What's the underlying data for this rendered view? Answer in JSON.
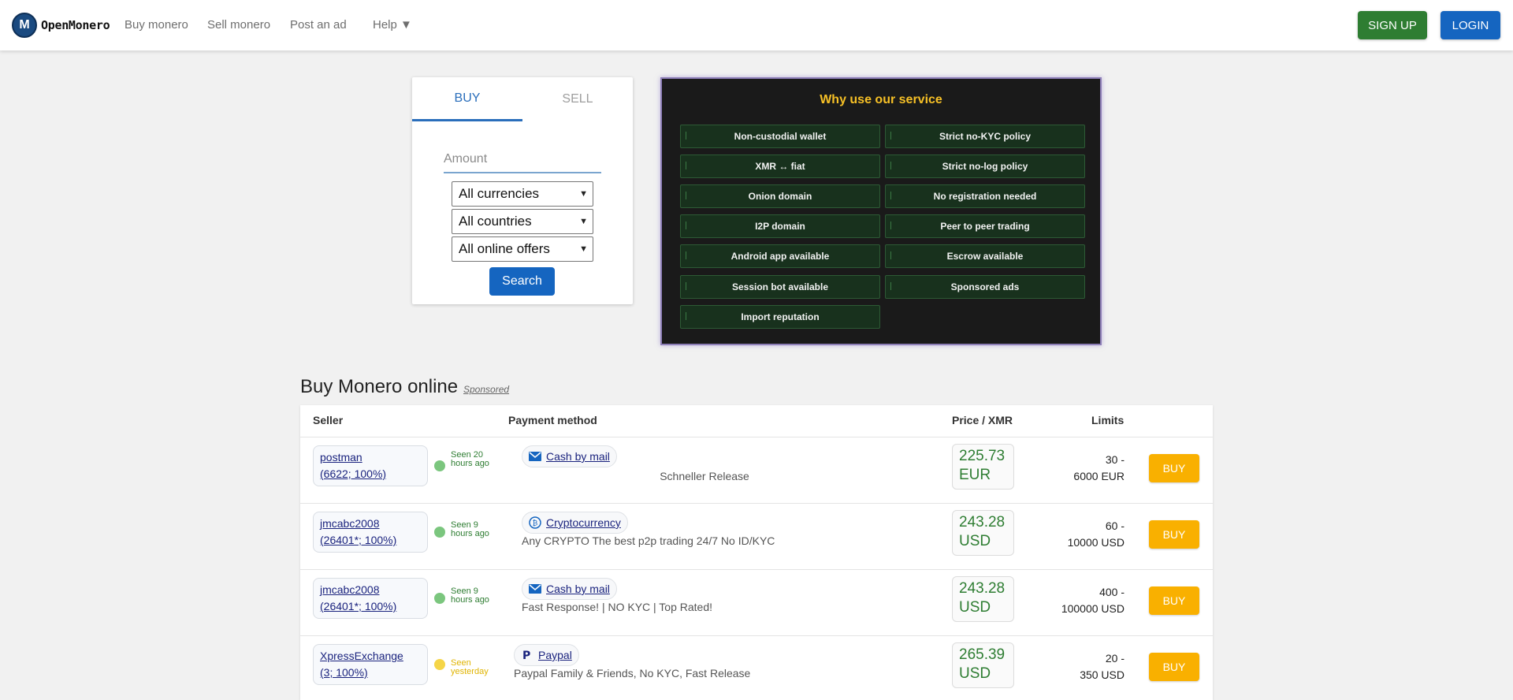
{
  "header": {
    "logo_text": "OpenMonero",
    "nav": [
      "Buy monero",
      "Sell monero",
      "Post an ad",
      "Help ▼"
    ],
    "signup_label": "SIGN UP",
    "login_label": "LOGIN"
  },
  "search": {
    "tabs": [
      "BUY",
      "SELL"
    ],
    "amount_placeholder": "Amount",
    "currency_selected": "All currencies",
    "country_selected": "All countries",
    "offer_selected": "All online offers",
    "search_label": "Search"
  },
  "why": {
    "title": "Why use our service",
    "features": [
      "Non-custodial wallet",
      "Strict no-KYC policy",
      "XMR ↔ fiat",
      "Strict no-log policy",
      "Onion domain",
      "No registration needed",
      "I2P domain",
      "Peer to peer trading",
      "Android app available",
      "Escrow available",
      "Session bot available",
      "Sponsored ads",
      "Import reputation"
    ]
  },
  "listings": {
    "title": "Buy Monero online",
    "sponsored_label": "Sponsored",
    "headers": [
      "Seller",
      "Payment method",
      "Price / XMR",
      "Limits"
    ],
    "rows": [
      {
        "seller_name": "postman",
        "seller_stats": "(6622; 100%)",
        "seen": "Seen 20 hours ago",
        "status_color": "#7bc67e",
        "flags": "",
        "payment_method": "Cash by mail",
        "payment_icon": "envelope-icon",
        "description": " ﾠﾠﾠﾠﾠﾠﾠ ﾠﾠﾠﾠﾠﾠ Schneller Release",
        "price": "225.73",
        "currency": "EUR",
        "limits_top": "30 -",
        "limits_bottom": "6000 EUR",
        "buy_label": "BUY"
      },
      {
        "seller_name": "jmcabc2008",
        "seller_stats": "(26401*; 100%)",
        "seen": "Seen 9 hours ago",
        "status_color": "#7bc67e",
        "flags": "",
        "payment_method": "Cryptocurrency",
        "payment_icon": "crypto-coin-icon",
        "description": " Any CRYPTO  The best p2p trading  24/7  No ID/KYC",
        "price": "243.28",
        "currency": "USD",
        "limits_top": "60 -",
        "limits_bottom": "10000 USD",
        "buy_label": "BUY"
      },
      {
        "seller_name": "jmcabc2008",
        "seller_stats": "(26401*; 100%)",
        "seen": "Seen 9 hours ago",
        "status_color": "#7bc67e",
        "flags": "",
        "payment_method": "Cash by mail",
        "payment_icon": "envelope-icon",
        "description": "Fast Response! | NO KYC | Top Rated!",
        "price": "243.28",
        "currency": "USD",
        "limits_top": "400 -",
        "limits_bottom": "100000 USD",
        "buy_label": "BUY"
      },
      {
        "seller_name": "XpressExchange",
        "seller_stats": "(3; 100%)",
        "seen": "Seen yesterday",
        "status_color": "#f5d547",
        "flags": "",
        "payment_method": "Paypal",
        "payment_icon": "paypal-icon",
        "description": "Paypal Family & Friends, No KYC, Fast Release",
        "price": "265.39",
        "currency": "USD",
        "limits_top": "20 -",
        "limits_bottom": "350 USD",
        "buy_label": "BUY"
      }
    ]
  }
}
